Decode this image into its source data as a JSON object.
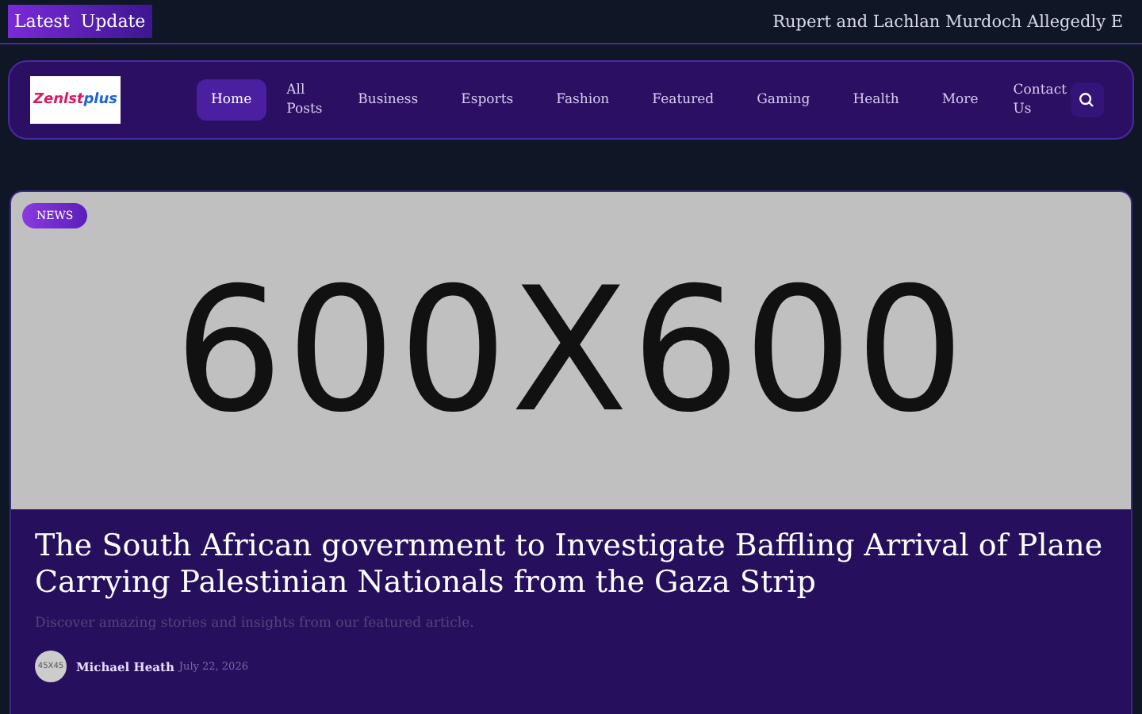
{
  "ticker": {
    "label": "Latest  Update",
    "headline": "Rupert and Lachlan Murdoch Allegedly E"
  },
  "header": {
    "logo": {
      "text_1": "Zenlst",
      "text_2": "plus"
    },
    "nav": [
      {
        "label": "Home",
        "selected": true
      },
      {
        "label": "All Posts",
        "selected": false
      },
      {
        "label": "Business",
        "selected": false
      },
      {
        "label": "Esports",
        "selected": false
      },
      {
        "label": "Fashion",
        "selected": false
      },
      {
        "label": "Featured",
        "selected": false
      },
      {
        "label": "Gaming",
        "selected": false
      },
      {
        "label": "Health",
        "selected": false
      },
      {
        "label": "More",
        "selected": false
      },
      {
        "label": "Contact Us",
        "selected": false
      }
    ]
  },
  "featured": {
    "category": "NEWS",
    "image_label": "600X600",
    "title": "The South African government to Investigate Baffling Arrival of Plane Carrying Palestinian Nationals from the Gaza Strip",
    "subtitle": "Discover amazing stories and insights from our featured article.",
    "author": {
      "avatar_label": "45X45",
      "name": "Michael Heath",
      "date": "July 22, 2026"
    }
  }
}
